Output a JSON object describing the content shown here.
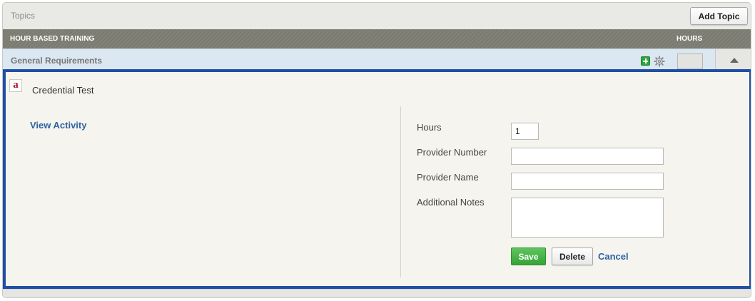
{
  "topics": {
    "title": "Topics",
    "add_button_label": "Add Topic"
  },
  "table_header": {
    "left_label": "HOUR BASED TRAINING",
    "right_label": "HOURS"
  },
  "requirement": {
    "title": "General Requirements",
    "hours_value": "",
    "icons": [
      "plus-icon",
      "gear-icon",
      "chevron-up-icon"
    ]
  },
  "activity": {
    "icon_letter": "a",
    "title": "Credential Test",
    "view_link": "View Activity",
    "form": {
      "hours_label": "Hours",
      "hours_value": "1",
      "provider_number_label": "Provider Number",
      "provider_number_value": "",
      "provider_name_label": "Provider Name",
      "provider_name_value": "",
      "notes_label": "Additional Notes",
      "notes_value": ""
    },
    "buttons": {
      "save": "Save",
      "delete": "Delete",
      "cancel": "Cancel"
    }
  },
  "colors": {
    "highlight_border": "#1f4fa6",
    "link": "#2f62a4",
    "save_green": "#35a435",
    "header_bar": "#7b7a70"
  }
}
